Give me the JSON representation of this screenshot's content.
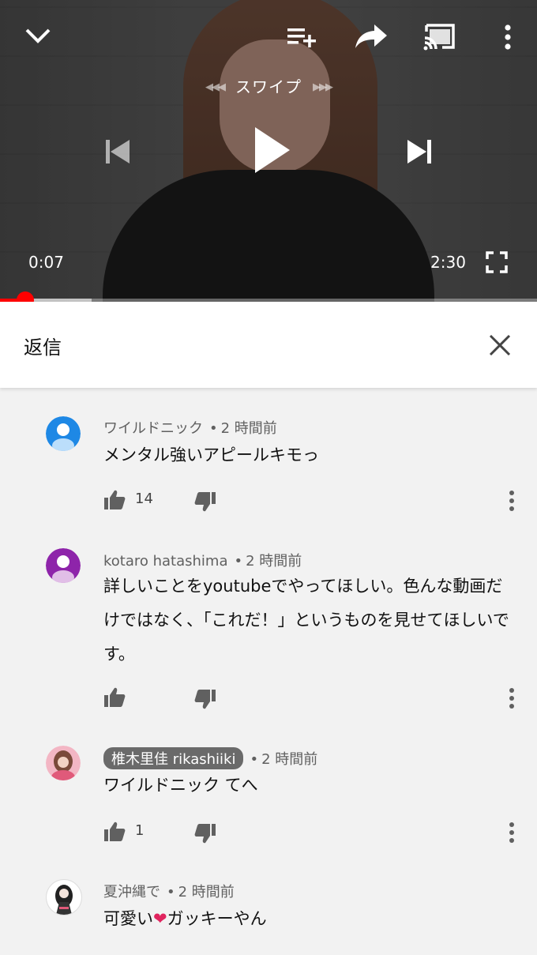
{
  "player": {
    "swipe_label": "スワイプ",
    "swipe_left_arrows": "◀◀◀",
    "swipe_right_arrows": "▶▶▶",
    "current_time": "0:07",
    "duration": "2:30",
    "progress_fraction": 0.047,
    "buffered_fraction": 0.17
  },
  "reply_panel": {
    "title": "返信"
  },
  "comments": [
    {
      "author": "ワイルドニック",
      "time": "2 時間前",
      "text": "メンタル強いアピールキモっ",
      "likes": "14",
      "avatar_color": "#1e88e5"
    },
    {
      "author": "kotaro hatashima",
      "time": "2 時間前",
      "text": "詳しいことをyoutubeでやってほしい。色んな動画だけではなく、「これだ！」というものを見せてほしいです。",
      "likes": "",
      "avatar_color": "#8e24aa"
    },
    {
      "author": "椎木里佳 rikashiiki",
      "time": "2 時間前",
      "text": "ワイルドニック てへ",
      "likes": "1",
      "avatar_color": "#f3b6c4"
    },
    {
      "author": "夏沖縄で",
      "time": "2 時間前",
      "text_before": "可愛い",
      "heart": "❤",
      "text_after": "ガッキーやん",
      "avatar_color": "#ffffff"
    }
  ],
  "colors": {
    "accent": "#ff0000",
    "background": "#f2f2f2",
    "meta_text": "#606060"
  }
}
